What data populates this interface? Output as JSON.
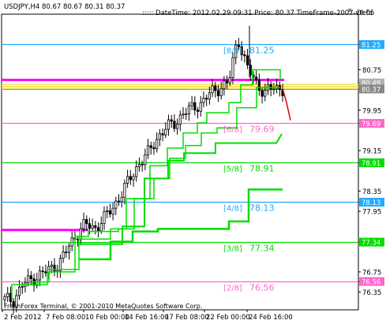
{
  "window": {
    "header_left": "USDJPY,H4  80.67 80.67 80.31 80.37",
    "header_right": "::::: DateTime: 2012.02.29 09:31    Price: 80.37    TimeFrame-2007-v0.05",
    "header_trail": "Defa",
    "footer": "FreshForex Terminal, © 2001-2010 MetaQuotes Software Corp."
  },
  "colors": {
    "background": "#ffffff",
    "axis": "#000000",
    "octave_green": "#00dd00",
    "octave_blue": "#22aaff",
    "octave_pink": "#ff66cc",
    "magenta": "#ff00ff",
    "yellow": "#eedd44",
    "price_label_bg": "#b0b0b0",
    "candle": "#000000"
  },
  "levels": [
    {
      "name": "[8/8]",
      "value": "81.25",
      "color": "#22aaff"
    },
    {
      "name": "[6/8]",
      "value": "79.69",
      "color": "#ff66cc"
    },
    {
      "name": "[5/8]",
      "value": "78.91",
      "color": "#00dd00"
    },
    {
      "name": "[4/8]",
      "value": "78.13",
      "color": "#22aaff"
    },
    {
      "name": "[3/8]",
      "value": "77.34",
      "color": "#00dd00"
    },
    {
      "name": "[2/8]",
      "value": "76.56",
      "color": "#ff66cc"
    }
  ],
  "price_axis": {
    "ticks": [
      "81.25",
      "80.75",
      "80.49",
      "80.37",
      "79.95",
      "79.69",
      "79.15",
      "78.91",
      "78.35",
      "78.13",
      "77.95",
      "77.34",
      "76.75",
      "76.56",
      "76.35"
    ]
  },
  "time_axis": {
    "labels": [
      "2 Feb 2012",
      "7 Feb 08:00",
      "10 Feb 00:00",
      "14 Feb 16:00",
      "17 Feb 08:00",
      "22 Feb 00:00",
      "24 Feb 16:00"
    ]
  },
  "chart_data": {
    "type": "line",
    "symbol": "USDJPY",
    "timeframe": "H4",
    "ohlc_last": {
      "open": 80.67,
      "high": 80.67,
      "low": 80.31,
      "close": 80.37
    },
    "price": 80.37,
    "x": [
      "2 Feb 2012",
      "7 Feb 08:00",
      "10 Feb 00:00",
      "14 Feb 16:00",
      "17 Feb 08:00",
      "22 Feb 00:00",
      "24 Feb 16:00"
    ],
    "ylim": [
      76.0,
      81.85
    ],
    "close_path": [
      76.2,
      76.2,
      76.5,
      76.6,
      76.7,
      76.8,
      76.9,
      77.2,
      77.5,
      77.7,
      77.6,
      77.8,
      78.0,
      78.3,
      78.6,
      78.9,
      79.1,
      79.4,
      79.6,
      79.7,
      79.9,
      80.0,
      80.1,
      80.3,
      80.4,
      80.5,
      81.4,
      80.8,
      80.5,
      80.3,
      80.4,
      80.37
    ],
    "series": [
      {
        "name": "octave-horizontal-levels",
        "values": [
          81.25,
          79.69,
          78.91,
          78.13,
          77.34,
          76.56
        ]
      }
    ]
  }
}
